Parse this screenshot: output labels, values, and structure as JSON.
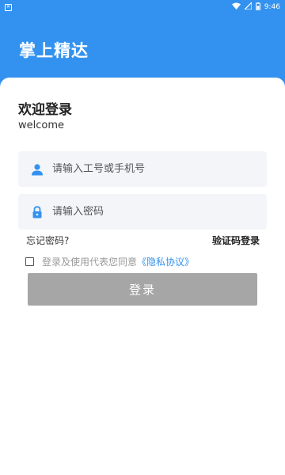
{
  "status_bar": {
    "time": "9:46",
    "notification_icon": "notification-box-icon",
    "wifi_icon": "wifi-icon",
    "signal_icon": "signal-icon",
    "battery_icon": "battery-icon"
  },
  "header": {
    "title": "掌上精达"
  },
  "welcome": {
    "title": "欢迎登录",
    "subtitle": "welcome"
  },
  "form": {
    "account_placeholder": "请输入工号或手机号",
    "account_icon": "user-icon",
    "password_placeholder": "请输入密码",
    "password_icon": "lock-icon"
  },
  "links": {
    "forgot_password": "忘记密码?",
    "sms_login": "验证码登录"
  },
  "agreement": {
    "text": "登录及使用代表您同意",
    "link": "《隐私协议》",
    "checked": false
  },
  "login_button": {
    "label": "登录"
  },
  "colors": {
    "primary": "#3392ef",
    "field_bg": "#f3f5f9",
    "button_disabled": "#a6a6a6"
  }
}
